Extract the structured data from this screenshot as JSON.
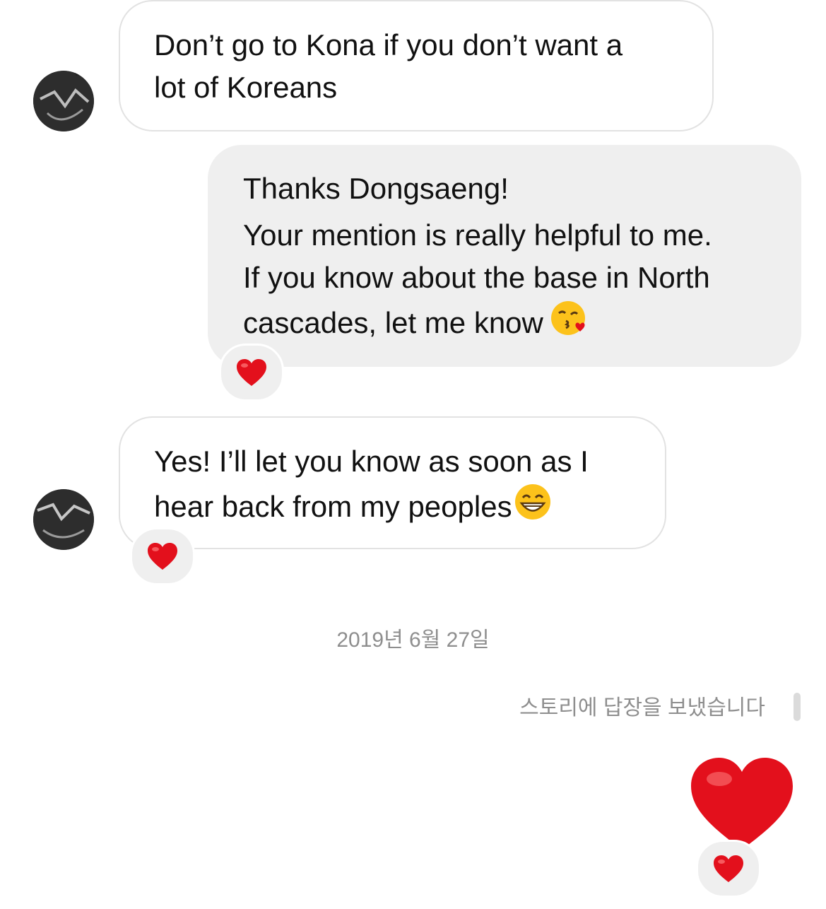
{
  "messages": [
    {
      "sender": "other",
      "lines": [
        "Don’t go to Kona if you don’t want a",
        "lot of Koreans"
      ]
    },
    {
      "sender": "me",
      "lines": [
        "Thanks Dongsaeng!",
        "Your mention is really helpful to me.",
        "If you know about the base in North",
        "cascades, let me know"
      ],
      "emoji": "face-blowing-kiss",
      "reaction": "red-heart"
    },
    {
      "sender": "other",
      "lines": [
        "Yes! I’ll let you know as soon as I",
        "hear back from my peoples"
      ],
      "emoji": "grinning-face",
      "reaction": "red-heart"
    }
  ],
  "date_divider": "2019년 6월 27일",
  "story_reply_note": "스토리에 답장을 보냈습니다",
  "big_heart": {
    "emoji": "red-heart",
    "reaction": "red-heart"
  },
  "colors": {
    "heart": "#e3101c",
    "incoming_bubble_border": "#e2e2e2",
    "outgoing_bubble_bg": "#efefef",
    "meta_text": "#8e8e8e"
  }
}
